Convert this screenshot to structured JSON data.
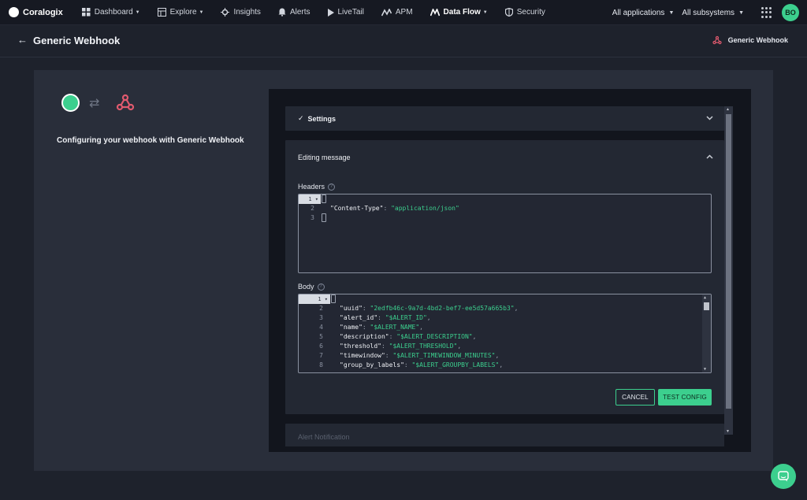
{
  "nav": {
    "logo": "Coralogix",
    "items": [
      {
        "label": "Dashboard",
        "icon": "dashboard-icon",
        "dropdown": true
      },
      {
        "label": "Explore",
        "icon": "explore-icon",
        "dropdown": true
      },
      {
        "label": "Insights",
        "icon": "insights-icon",
        "dropdown": false
      },
      {
        "label": "Alerts",
        "icon": "bell-icon",
        "dropdown": false
      },
      {
        "label": "LiveTail",
        "icon": "play-icon",
        "dropdown": false
      },
      {
        "label": "APM",
        "icon": "apm-icon",
        "dropdown": false
      },
      {
        "label": "Data Flow",
        "icon": "data-flow-icon",
        "dropdown": true
      },
      {
        "label": "Security",
        "icon": "shield-icon",
        "dropdown": false
      }
    ],
    "applications": "All applications",
    "subsystems": "All subsystems",
    "avatar": "BO"
  },
  "header": {
    "title": "Generic Webhook",
    "integration": "Generic Webhook"
  },
  "left": {
    "configuring": "Configuring your webhook with Generic Webhook"
  },
  "settings": {
    "check": "✓",
    "title": "Settings"
  },
  "editing": {
    "title": "Editing message",
    "headers_label": "Headers",
    "body_label": "Body",
    "headers_gutter": [
      "1",
      "2",
      "3"
    ],
    "body_gutter": [
      "1",
      "2",
      "3",
      "4",
      "5",
      "6",
      "7",
      "8"
    ],
    "headers_code": [
      {
        "key": "\"Content-Type\"",
        "value": "\"application/json\"",
        "trail": ""
      }
    ],
    "body_code": [
      {
        "key": "\"uuid\"",
        "value": "\"2edfb46c-9a7d-4bd2-bef7-ee5d57a665b3\"",
        "trail": ","
      },
      {
        "key": "\"alert_id\"",
        "value": "\"$ALERT_ID\"",
        "trail": ","
      },
      {
        "key": "\"name\"",
        "value": "\"$ALERT_NAME\"",
        "trail": ","
      },
      {
        "key": "\"description\"",
        "value": "\"$ALERT_DESCRIPTION\"",
        "trail": ","
      },
      {
        "key": "\"threshold\"",
        "value": "\"$ALERT_THRESHOLD\"",
        "trail": ","
      },
      {
        "key": "\"timewindow\"",
        "value": "\"$ALERT_TIMEWINDOW_MINUTES\"",
        "trail": ","
      },
      {
        "key": "\"group_by_labels\"",
        "value": "\"$ALERT_GROUPBY_LABELS\"",
        "trail": ","
      }
    ],
    "cancel": "CANCEL",
    "test": "TEST CONFIG"
  },
  "next_section": {
    "title": "Alert Notification"
  },
  "colors": {
    "accent": "#3ccf8e",
    "background": "#1e222c",
    "panel": "#292e3a",
    "inner": "#12151d",
    "webhook": "#e05a6e"
  }
}
